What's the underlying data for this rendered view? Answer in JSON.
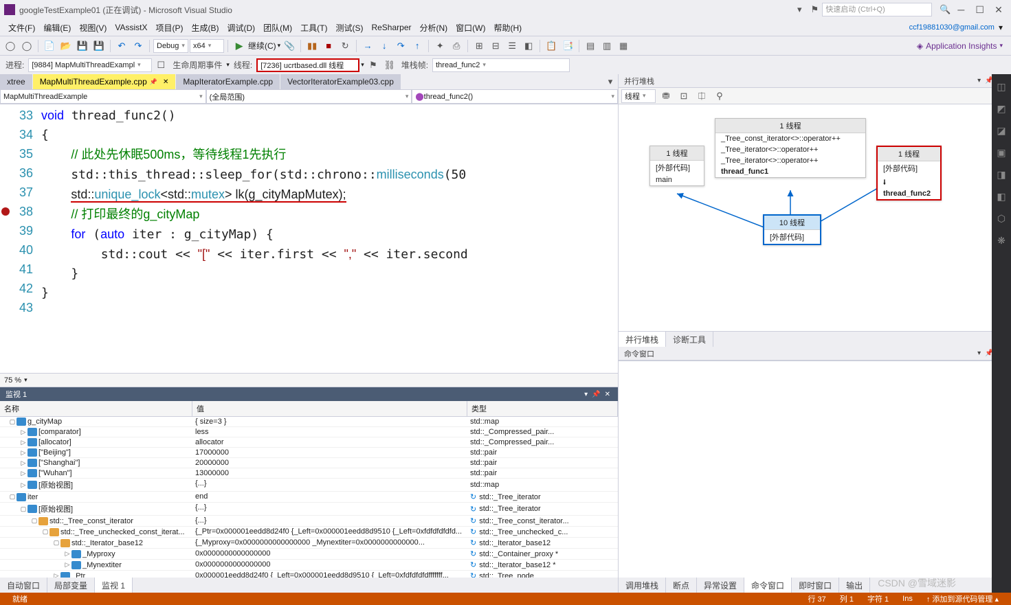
{
  "title": "googleTestExample01 (正在调试) - Microsoft Visual Studio",
  "quick_launch_placeholder": "快速启动 (Ctrl+Q)",
  "menu": [
    "文件(F)",
    "编辑(E)",
    "视图(V)",
    "VAssistX",
    "项目(P)",
    "生成(B)",
    "调试(D)",
    "团队(M)",
    "工具(T)",
    "测试(S)",
    "ReSharper",
    "分析(N)",
    "窗口(W)",
    "帮助(H)"
  ],
  "user_email": "ccf19881030@gmail.com",
  "app_insights": "Application Insights",
  "toolbar": {
    "config": "Debug",
    "platform": "x64",
    "continue": "继续(C)"
  },
  "debug_bar": {
    "process_label": "进程:",
    "process": "[9884] MapMultiThreadExampl",
    "lifecycle": "生命周期事件",
    "thread_label": "线程:",
    "thread": "[7236] ucrtbased.dll 线程",
    "stackframe_label": "堆栈帧:",
    "stackframe": "thread_func2"
  },
  "tabs": [
    {
      "label": "xtree",
      "active": false
    },
    {
      "label": "MapMultiThreadExample.cpp",
      "active": true
    },
    {
      "label": "MapIteratorExample.cpp",
      "active": false
    },
    {
      "label": "VectorIteratorExample03.cpp",
      "active": false
    }
  ],
  "nav": {
    "scope": "MapMultiThreadExample",
    "region": "(全局范围)",
    "func": "thread_func2()"
  },
  "code_lines_start": 33,
  "zoom": "75 %",
  "watch": {
    "title": "监视 1",
    "headers": {
      "name": "名称",
      "value": "值",
      "type": "类型"
    },
    "rows": [
      {
        "depth": 0,
        "exp": "▢",
        "icon": "field",
        "name": "g_cityMap",
        "value": "{ size=3 }",
        "type": "std::map<std::basic_stri..."
      },
      {
        "depth": 1,
        "exp": "▷",
        "icon": "field",
        "name": "[comparator]",
        "value": "less",
        "type": "std::_Compressed_pair..."
      },
      {
        "depth": 1,
        "exp": "▷",
        "icon": "field",
        "name": "[allocator]",
        "value": "allocator",
        "type": "std::_Compressed_pair..."
      },
      {
        "depth": 1,
        "exp": "▷",
        "icon": "field",
        "name": "[\"Beijing\"]",
        "value": "17000000",
        "type": "std::pair<std::basic_stri..."
      },
      {
        "depth": 1,
        "exp": "▷",
        "icon": "field",
        "name": "[\"Shanghai\"]",
        "value": "20000000",
        "type": "std::pair<std::basic_stri..."
      },
      {
        "depth": 1,
        "exp": "▷",
        "icon": "field",
        "name": "[\"Wuhan\"]",
        "value": "13000000",
        "type": "std::pair<std::basic_stri..."
      },
      {
        "depth": 1,
        "exp": "▷",
        "icon": "field",
        "name": "[原始视图]",
        "value": "{...}",
        "type": "std::map<std::basic_stri..."
      },
      {
        "depth": 0,
        "exp": "▢",
        "icon": "field",
        "name": "iter",
        "value": "end",
        "refresh": true,
        "type": "std::_Tree_iterator<std::..."
      },
      {
        "depth": 1,
        "exp": "▢",
        "icon": "field",
        "name": "[原始视图]",
        "value": "{...}",
        "refresh": true,
        "type": "std::_Tree_iterator<std::..."
      },
      {
        "depth": 2,
        "exp": "▢",
        "icon": "class",
        "name": "std::_Tree_const_iterator<std::_Tree_v...",
        "value": "{...}",
        "refresh": true,
        "type": "std::_Tree_const_iterator..."
      },
      {
        "depth": 3,
        "exp": "▢",
        "icon": "class",
        "name": "std::_Tree_unchecked_const_iterat...",
        "value": "{_Ptr=0x000001eedd8d24f0 {_Left=0x000001eedd8d9510 {_Left=0xfdfdfdfdfd...",
        "refresh": true,
        "type": "std::_Tree_unchecked_c..."
      },
      {
        "depth": 4,
        "exp": "▢",
        "icon": "class",
        "name": "std::_Iterator_base12",
        "value": "{_Myproxy=0x0000000000000000 <NULL> _Mynextiter=0x0000000000000...",
        "refresh": true,
        "type": "std::_Iterator_base12"
      },
      {
        "depth": 5,
        "exp": "▷",
        "icon": "field",
        "name": "_Myproxy",
        "value": "0x0000000000000000 <NULL>",
        "refresh": true,
        "type": "std::_Container_proxy *"
      },
      {
        "depth": 5,
        "exp": "▷",
        "icon": "field",
        "name": "_Mynextiter",
        "value": "0x0000000000000000 <NULL>",
        "refresh": true,
        "type": "std::_Iterator_base12 *"
      },
      {
        "depth": 4,
        "exp": "▷",
        "icon": "field",
        "name": "_Ptr",
        "value": "0x000001eedd8d24f0 {_Left=0x000001eedd8d9510 {_Left=0xfdfdfdfdfffffff...",
        "refresh": true,
        "type": "std::_Tree_node<std::pa..."
      }
    ]
  },
  "bottom_tabs_left": [
    "自动窗口",
    "局部变量",
    "监视 1"
  ],
  "parallel": {
    "title": "并行堆栈",
    "combo": "线程",
    "tabs": [
      "并行堆栈",
      "诊断工具"
    ],
    "boxes": {
      "left": {
        "head": "1 线程",
        "items": [
          "[外部代码]",
          "main"
        ]
      },
      "mid": {
        "head": "1 线程",
        "items": [
          "_Tree_const_iterator<>::operator++",
          "_Tree_iterator<>::operator++",
          "_Tree_iterator<>::operator++",
          "thread_func1"
        ]
      },
      "right": {
        "head": "1 线程",
        "items": [
          "[外部代码]",
          "thread_func2"
        ]
      },
      "bottom": {
        "head": "10 线程",
        "items": [
          "[外部代码]"
        ]
      }
    }
  },
  "cmd_title": "命令窗口",
  "bottom_tabs_right": [
    "调用堆栈",
    "断点",
    "异常设置",
    "命令窗口",
    "即时窗口",
    "输出"
  ],
  "status": {
    "ready": "就绪",
    "line": "行 37",
    "col": "列 1",
    "char": "字符 1",
    "ins": "Ins",
    "source": "添加到源代码管理"
  },
  "watermark": "CSDN @雪域迷影"
}
